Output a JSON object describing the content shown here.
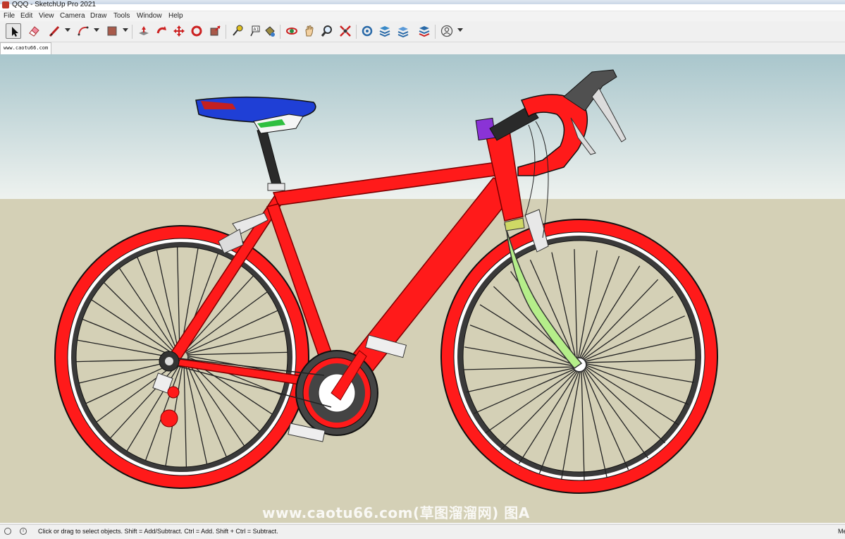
{
  "window": {
    "title": "QQQ - SketchUp Pro 2021"
  },
  "menu": [
    "File",
    "Edit",
    "View",
    "Camera",
    "Draw",
    "Tools",
    "Window",
    "Help"
  ],
  "toolbar": {
    "tools": [
      {
        "name": "select-tool-icon",
        "selected": true
      },
      {
        "name": "eraser-tool-icon"
      },
      {
        "name": "line-tool-icon"
      },
      {
        "name": "arc-tool-icon"
      },
      {
        "name": "rectangle-tool-icon"
      },
      {
        "name": "push-pull-tool-icon"
      },
      {
        "name": "rotate-tool-icon"
      },
      {
        "name": "move-tool-icon"
      },
      {
        "name": "follow-me-tool-icon"
      },
      {
        "name": "scale-tool-icon"
      },
      {
        "name": "tape-measure-tool-icon"
      },
      {
        "name": "text-tool-icon"
      },
      {
        "name": "paint-bucket-tool-icon"
      },
      {
        "name": "orbit-tool-icon"
      },
      {
        "name": "pan-tool-icon"
      },
      {
        "name": "zoom-tool-icon"
      },
      {
        "name": "zoom-extents-tool-icon"
      },
      {
        "name": "warehouse-icon"
      },
      {
        "name": "extension-warehouse-icon"
      },
      {
        "name": "layers-icon"
      },
      {
        "name": "extension-manager-icon"
      },
      {
        "name": "account-icon"
      }
    ]
  },
  "scene_tab": {
    "label": "www.caotu66.com"
  },
  "status": {
    "hint": "Click or drag to select objects. Shift = Add/Subtract. Ctrl = Add. Shift + Ctrl = Subtract.",
    "measurements_label": "Me"
  },
  "watermark": {
    "text": "www.caotu66.com(草图溜溜网) 图A"
  },
  "colors": {
    "frame": "#ff1a1a",
    "sky_top": "#a9c6cc",
    "sky_bottom": "#eef2ef",
    "ground": "#d4d0b6",
    "saddle": "#1f3fd6",
    "fork": "#b5ee8a",
    "headset": "#8a33d6",
    "tire_outer": "#ff1a1a",
    "rim_dark": "#3a3a3a"
  }
}
